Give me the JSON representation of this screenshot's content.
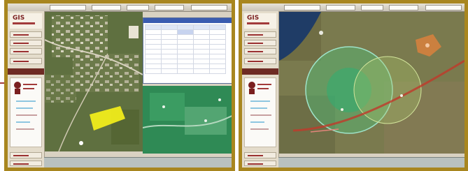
{
  "screens": [
    {
      "id": "left",
      "app_logo": "GIS",
      "view": "aerial-map-with-attribute-table"
    },
    {
      "id": "right",
      "app_logo": "GIS",
      "view": "satellite-map-with-buffer-zones"
    }
  ],
  "colors": {
    "frame": "#a8861f",
    "sidebar": "#e4dccb",
    "accent": "#7a1f1f",
    "table_header": "#3a5cb0",
    "highlight_polygon": "#f5f01a",
    "buffer_green": "#4fbf7a",
    "route_red": "#c0392b"
  }
}
